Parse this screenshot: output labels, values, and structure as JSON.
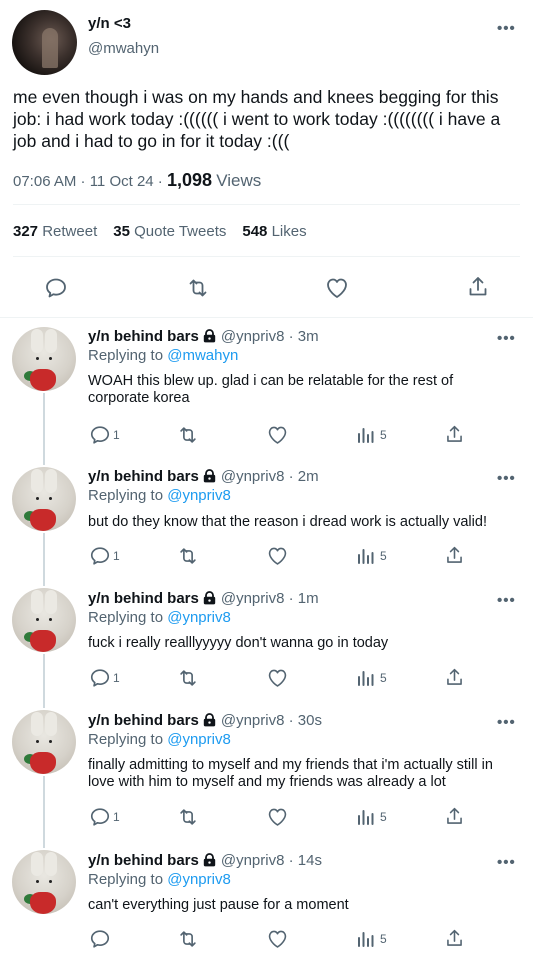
{
  "main_tweet": {
    "display_name": "y/n <3",
    "handle": "@mwahyn",
    "text": "me even though i was on my hands and knees begging for this job: i had work today :(((((( i went to work today :(((((((( i have a job and i had to go in for it today :(((",
    "time": "07:06 AM · 11 Oct 24 · ",
    "views_count": "1,098",
    "views_label": "Views",
    "stats": {
      "retweets": "327",
      "retweets_label": "Retweet",
      "quotes": "35",
      "quotes_label": "Quote Tweets",
      "likes": "548",
      "likes_label": "Likes"
    }
  },
  "replies": [
    {
      "name": "y/n behind bars",
      "meta": "@ynpriv8 · 3m",
      "replying_label": "Replying to ",
      "replying_to": "@mwahyn",
      "text": "WOAH this blew up. glad i can be relatable for the rest of corporate korea",
      "reply_count": "1",
      "views": "5"
    },
    {
      "name": "y/n behind bars",
      "meta": "@ynpriv8 · 2m",
      "replying_label": "Replying to ",
      "replying_to": "@ynpriv8",
      "text": "but do they know that the reason i dread work is actually valid!",
      "reply_count": "1",
      "views": "5"
    },
    {
      "name": "y/n behind bars",
      "meta": "@ynpriv8 · 1m",
      "replying_label": "Replying to ",
      "replying_to": "@ynpriv8",
      "text": "fuck i really realllyyyyy don't wanna go in today",
      "reply_count": "1",
      "views": "5"
    },
    {
      "name": "y/n behind bars",
      "meta": "@ynpriv8 · 30s",
      "replying_label": "Replying to ",
      "replying_to": "@ynpriv8",
      "text": "finally admitting to myself and my friends that i'm actually still in love with him to myself and my friends was already a lot",
      "reply_count": "1",
      "views": "5"
    },
    {
      "name": "y/n behind bars",
      "meta": "@ynpriv8 · 14s",
      "replying_label": "Replying to ",
      "replying_to": "@ynpriv8",
      "text": "can't everything just pause for a moment",
      "reply_count": "",
      "views": "5"
    }
  ],
  "icons": {
    "reply": "reply-icon",
    "retweet": "retweet-icon",
    "like": "heart-icon",
    "share": "share-icon",
    "views": "analytics-icon",
    "more": "more-icon",
    "lock": "lock-icon"
  },
  "colors": {
    "text": "#0f1419",
    "secondary": "#536471",
    "link": "#1d9bf0",
    "divider": "#eff3f4"
  }
}
